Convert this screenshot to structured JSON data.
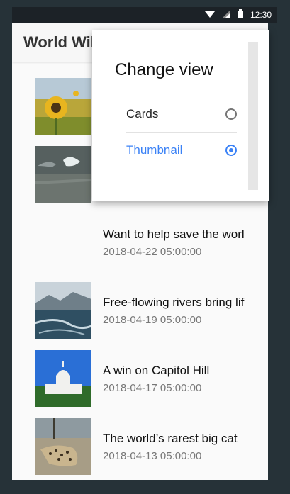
{
  "status": {
    "time": "12:30"
  },
  "app": {
    "title": "World Wildlife Fund"
  },
  "dialog": {
    "title": "Change view",
    "options": [
      {
        "label": "Cards",
        "selected": false
      },
      {
        "label": "Thumbnail",
        "selected": true
      }
    ]
  },
  "items": [
    {
      "title": "",
      "date": "",
      "thumb": "sunflower-image"
    },
    {
      "title": "",
      "date": "",
      "thumb": "dolphin-image"
    },
    {
      "title": "Want to help save the world?",
      "date": "2018-04-22 05:00:00",
      "thumb": "none"
    },
    {
      "title": "Free-flowing rivers bring life",
      "date": "2018-04-19 05:00:00",
      "thumb": "river-image"
    },
    {
      "title": "A win on Capitol Hill",
      "date": "2018-04-17 05:00:00",
      "thumb": "capitol-image"
    },
    {
      "title": "The world’s rarest big cat",
      "date": "2018-04-13 05:00:00",
      "thumb": "leopard-image"
    }
  ],
  "colors": {
    "accent": "#3b82f6",
    "statusbar": "#1c2227",
    "frame": "#263238"
  }
}
